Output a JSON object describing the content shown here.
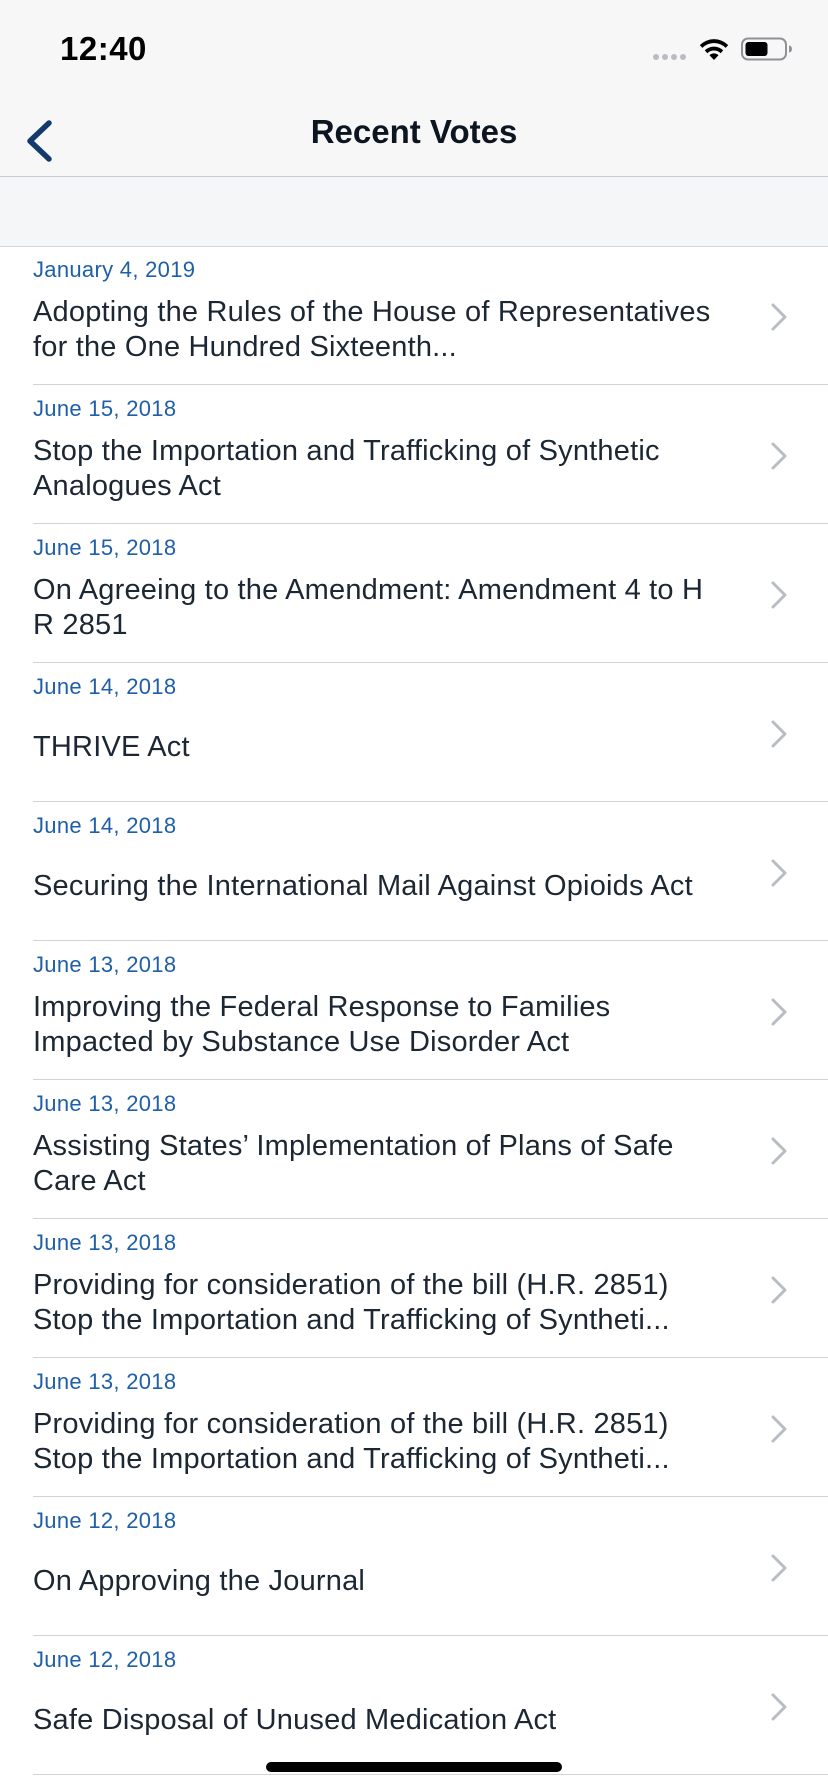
{
  "status_bar": {
    "time": "12:40"
  },
  "nav": {
    "title": "Recent Votes",
    "back_icon": "chevron-left-icon"
  },
  "colors": {
    "date": "#1f5fa8",
    "nav_accent": "#143a6b",
    "chevron": "#b8bcc3"
  },
  "votes": [
    {
      "date": "January 4, 2019",
      "title": "Adopting the Rules of the House of Representatives for the One Hundred Sixteenth..."
    },
    {
      "date": "June 15, 2018",
      "title": "Stop the Importation and Trafficking of Synthetic Analogues Act"
    },
    {
      "date": "June 15, 2018",
      "title": "On Agreeing to the Amendment: Amendment 4 to H R 2851"
    },
    {
      "date": "June 14, 2018",
      "title": "THRIVE Act"
    },
    {
      "date": "June 14, 2018",
      "title": "Securing the International Mail Against Opioids Act"
    },
    {
      "date": "June 13, 2018",
      "title": "Improving the Federal Response to Families Impacted by Substance Use Disorder Act"
    },
    {
      "date": "June 13, 2018",
      "title": "Assisting States’ Implementation of Plans of Safe Care Act"
    },
    {
      "date": "June 13, 2018",
      "title": "Providing for consideration of the bill (H.R. 2851) Stop the Importation and Trafficking of Syntheti..."
    },
    {
      "date": "June 13, 2018",
      "title": "Providing for consideration of the bill (H.R. 2851) Stop the Importation and Trafficking of Syntheti..."
    },
    {
      "date": "June 12, 2018",
      "title": "On Approving the Journal"
    },
    {
      "date": "June 12, 2018",
      "title": "Safe Disposal of Unused Medication Act"
    }
  ]
}
